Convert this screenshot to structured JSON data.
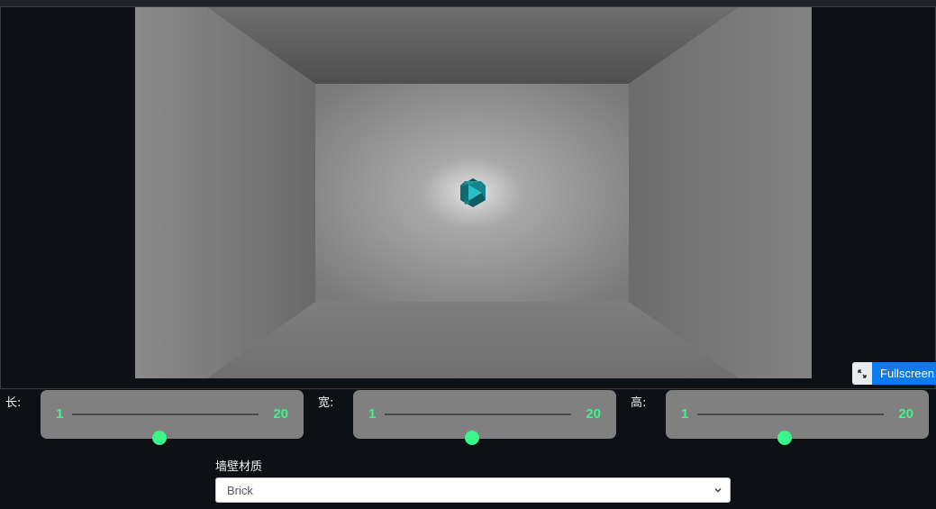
{
  "viewer": {
    "fullscreen_label": "Fullscreen",
    "fullscreen_icon": "expand-arrows-icon",
    "room_wall_color": "#7a7a7a",
    "object_color": "#1a8f96"
  },
  "dimensions": [
    {
      "label": "长:",
      "min": "1",
      "max": "20",
      "value_fraction": 0.47
    },
    {
      "label": "宽:",
      "min": "1",
      "max": "20",
      "value_fraction": 0.47
    },
    {
      "label": "高:",
      "min": "1",
      "max": "20",
      "value_fraction": 0.47
    }
  ],
  "material": {
    "label": "墙壁材质",
    "selected": "Brick"
  },
  "accent_color": "#39f58a"
}
